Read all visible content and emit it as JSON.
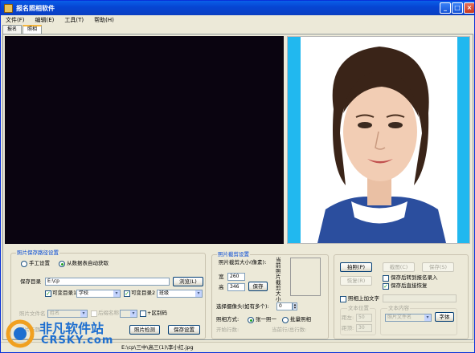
{
  "window": {
    "title": "报名照相软件"
  },
  "menu": [
    "文件(F)",
    "编辑(E)",
    "工具(T)",
    "帮助(H)"
  ],
  "tabs": [
    "报名",
    "照相"
  ],
  "save_path": {
    "title": "照片保存路径设置",
    "manual_label": "手工设置",
    "auto_label": "从数据表自动获取",
    "dir_label": "保存目录",
    "dir_value": "E:\\cp",
    "browse_btn": "浏览(L)",
    "var_dir1_label": "可变目录1",
    "var_dir1_value": "学校",
    "var_dir2_label": "可变目录2",
    "var_dir2_value": "班级",
    "file_name_label": "照片文件名",
    "file_name_value": "姓名",
    "suffix_label": "后缀名称",
    "distinguish_label": "+区别码",
    "photo_label": "照片标题",
    "detect_btn": "照片检测",
    "save_settings_btn": "保存设置"
  },
  "crop": {
    "title": "照片截剪设置",
    "size_label": "照片截剪大小(像素):",
    "width_label": "宽",
    "width_value": "260",
    "height_label": "高",
    "height_value": "346",
    "save_btn": "保存",
    "vertical_text": "当前照片截剪大小",
    "camera_label": "选择摄像头(如有多个):",
    "camera_value": "0",
    "mode_label": "照相方式:",
    "mode_single": "张一照一",
    "mode_batch": "批量照相",
    "start_row_label": "开始行数:",
    "current_label": "当前行/总行数:"
  },
  "actions": {
    "take_btn": "拍照(P)",
    "crop_btn": "截图(C)",
    "save_btn": "保存(S)",
    "restore_btn": "恢复(R)",
    "auto_import_label": "保存后转到报名录入",
    "direct_restore_label": "保存后直接恢复",
    "add_text_label": "照相上加文字",
    "text_pos_label": "文本位置",
    "text_content_label": "文本内容",
    "left_margin_label": "距左:",
    "left_margin_value": "50",
    "top_margin_label": "距顶:",
    "top_margin_value": "30",
    "content_value": "照片文件名",
    "font_btn": "字体"
  },
  "status": {
    "path": "E:\\cp\\三中\\高三(1)\\李小红.jpg"
  },
  "watermark": {
    "cn": "非凡软件站",
    "en": "CRSKY.com"
  }
}
